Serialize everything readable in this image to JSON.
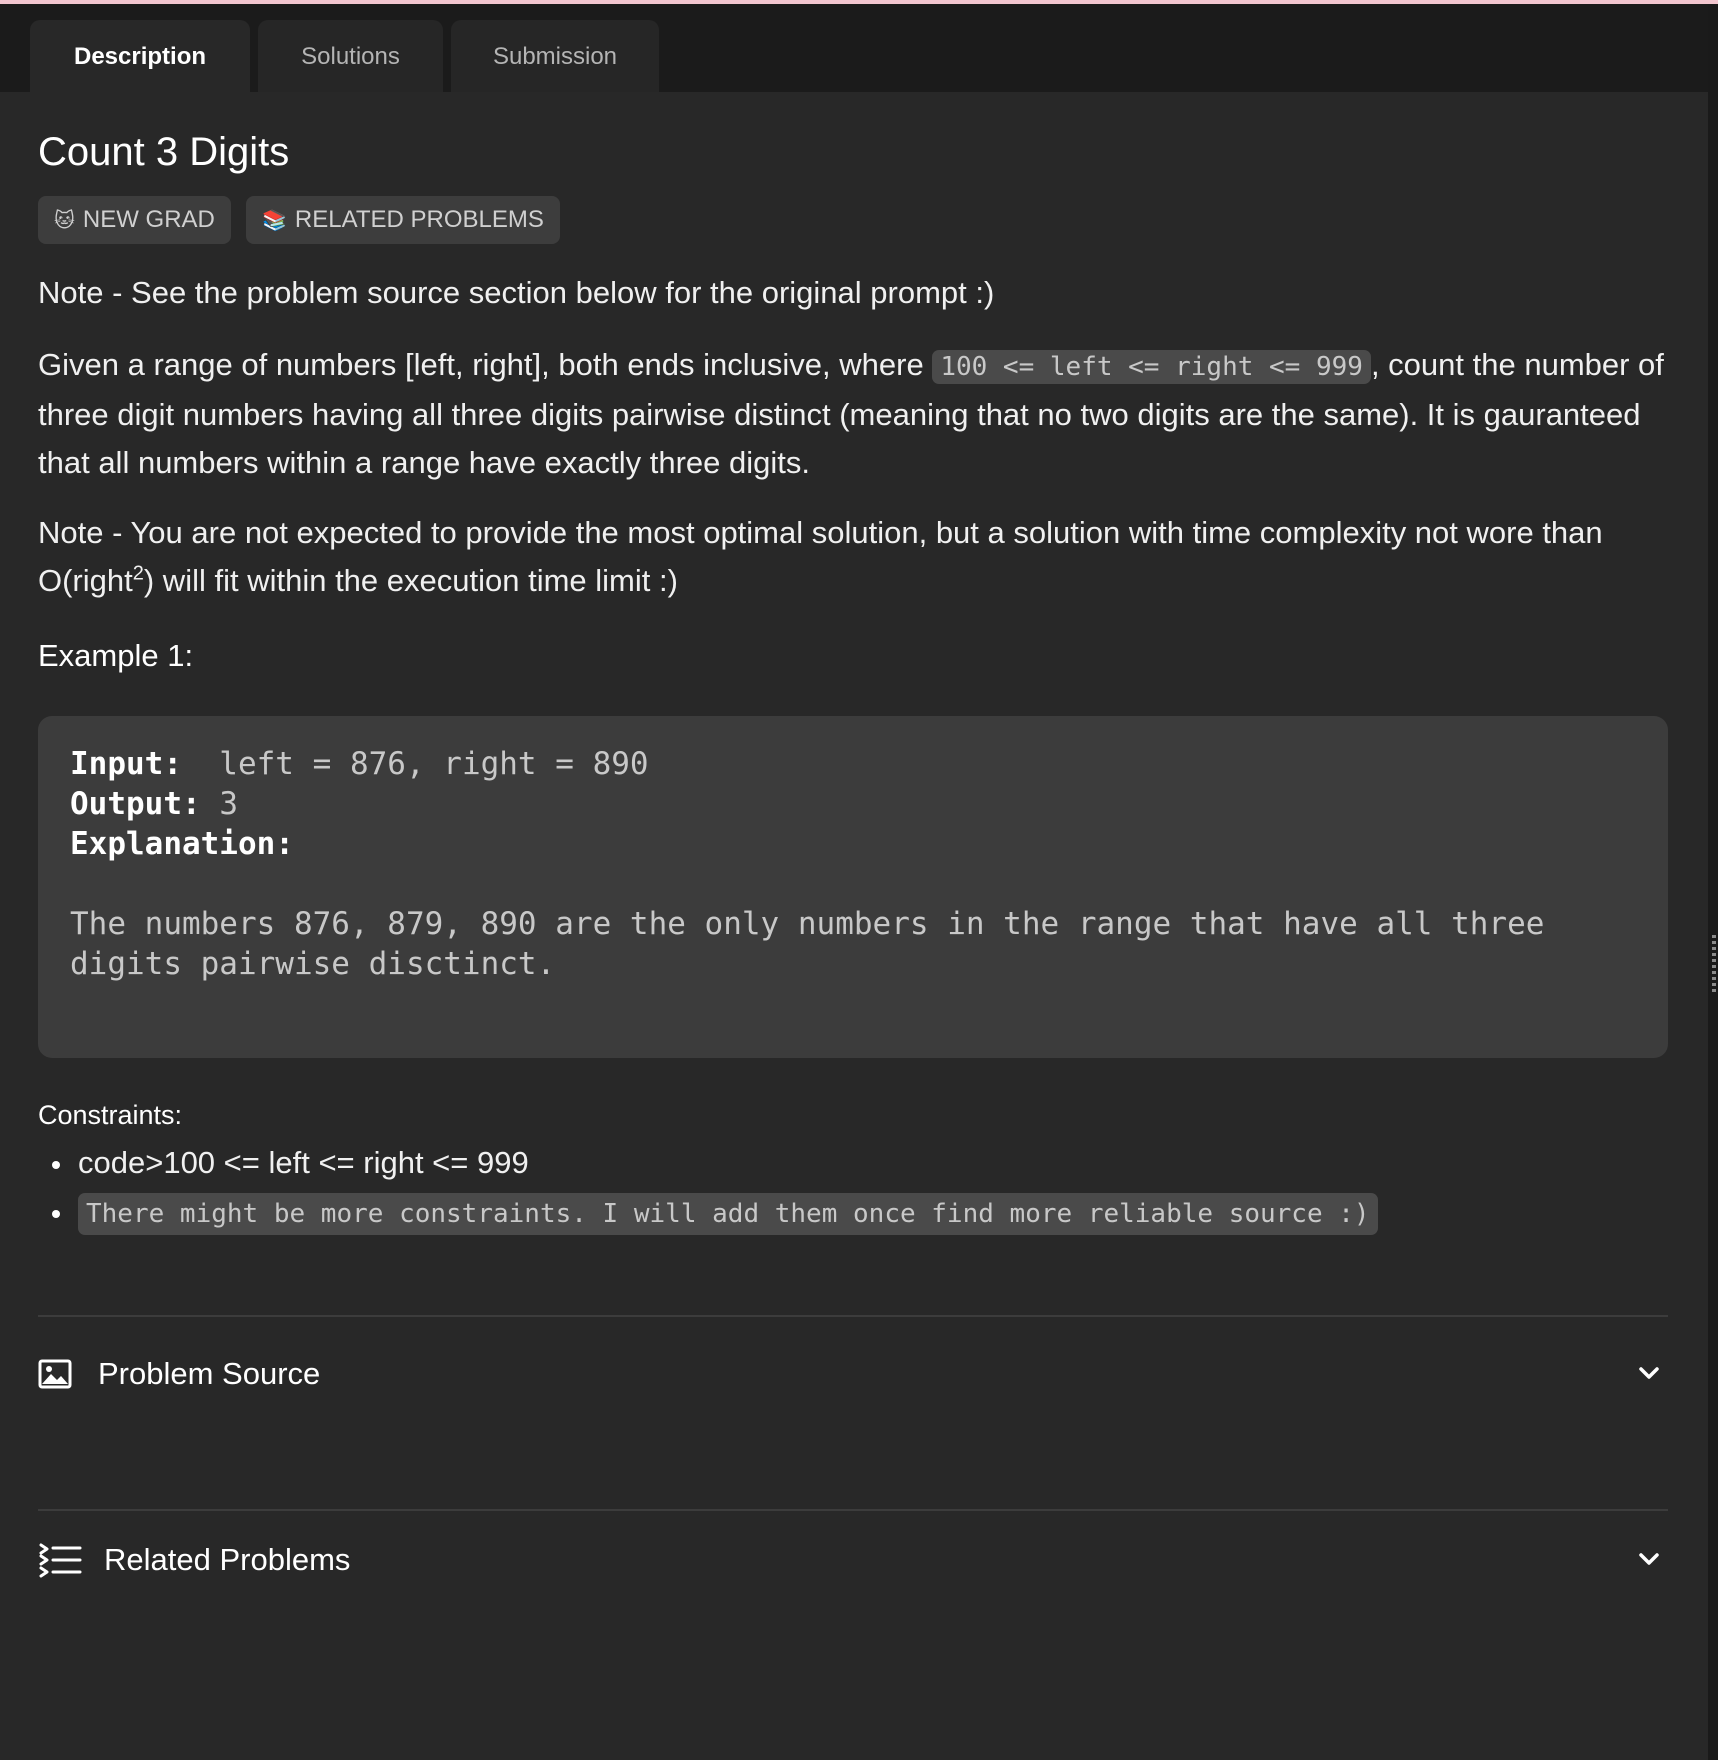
{
  "tabs": [
    {
      "label": "Description",
      "active": true
    },
    {
      "label": "Solutions",
      "active": false
    },
    {
      "label": "Submission",
      "active": false
    }
  ],
  "problem": {
    "title": "Count 3 Digits",
    "badges": [
      {
        "icon": "🐱",
        "label": "NEW GRAD"
      },
      {
        "icon": "📚",
        "label": "RELATED PROBLEMS"
      }
    ],
    "note1": "Note - See the problem source section below for the original prompt :)",
    "description": {
      "before": "Given a range of numbers [left, right], both ends inclusive, where ",
      "code": "100 <= left <= right <= 999",
      "after": ", count the number of three digit numbers having all three digits pairwise distinct (meaning that no two digits are the same). It is gauranteed that all numbers within a range have exactly three digits."
    },
    "note2": {
      "before": "Note - You are not expected to provide the most optimal solution, but a solution with time complexity not wore than O(right",
      "sup": "2",
      "after": ") will fit within the execution time limit :)"
    },
    "example_label": "Example 1:",
    "example": {
      "input_label": "Input:",
      "input_value": "  left = 876, right = 890",
      "output_label": "Output:",
      "output_value": " 3",
      "explanation_label": "Explanation:",
      "explanation_line1": "The numbers 876, 879, 890 are the only numbers in the range that have all three",
      "explanation_line2": "digits pairwise disctinct."
    },
    "constraints_label": "Constraints:",
    "constraints": [
      "code>100 <= left <= right <= 999",
      "There might be more constraints. I will add them once find more reliable source :)"
    ]
  },
  "sections": [
    {
      "label": "Problem Source",
      "icon": "image-icon"
    },
    {
      "label": "Related Problems",
      "icon": "list-icon"
    }
  ]
}
